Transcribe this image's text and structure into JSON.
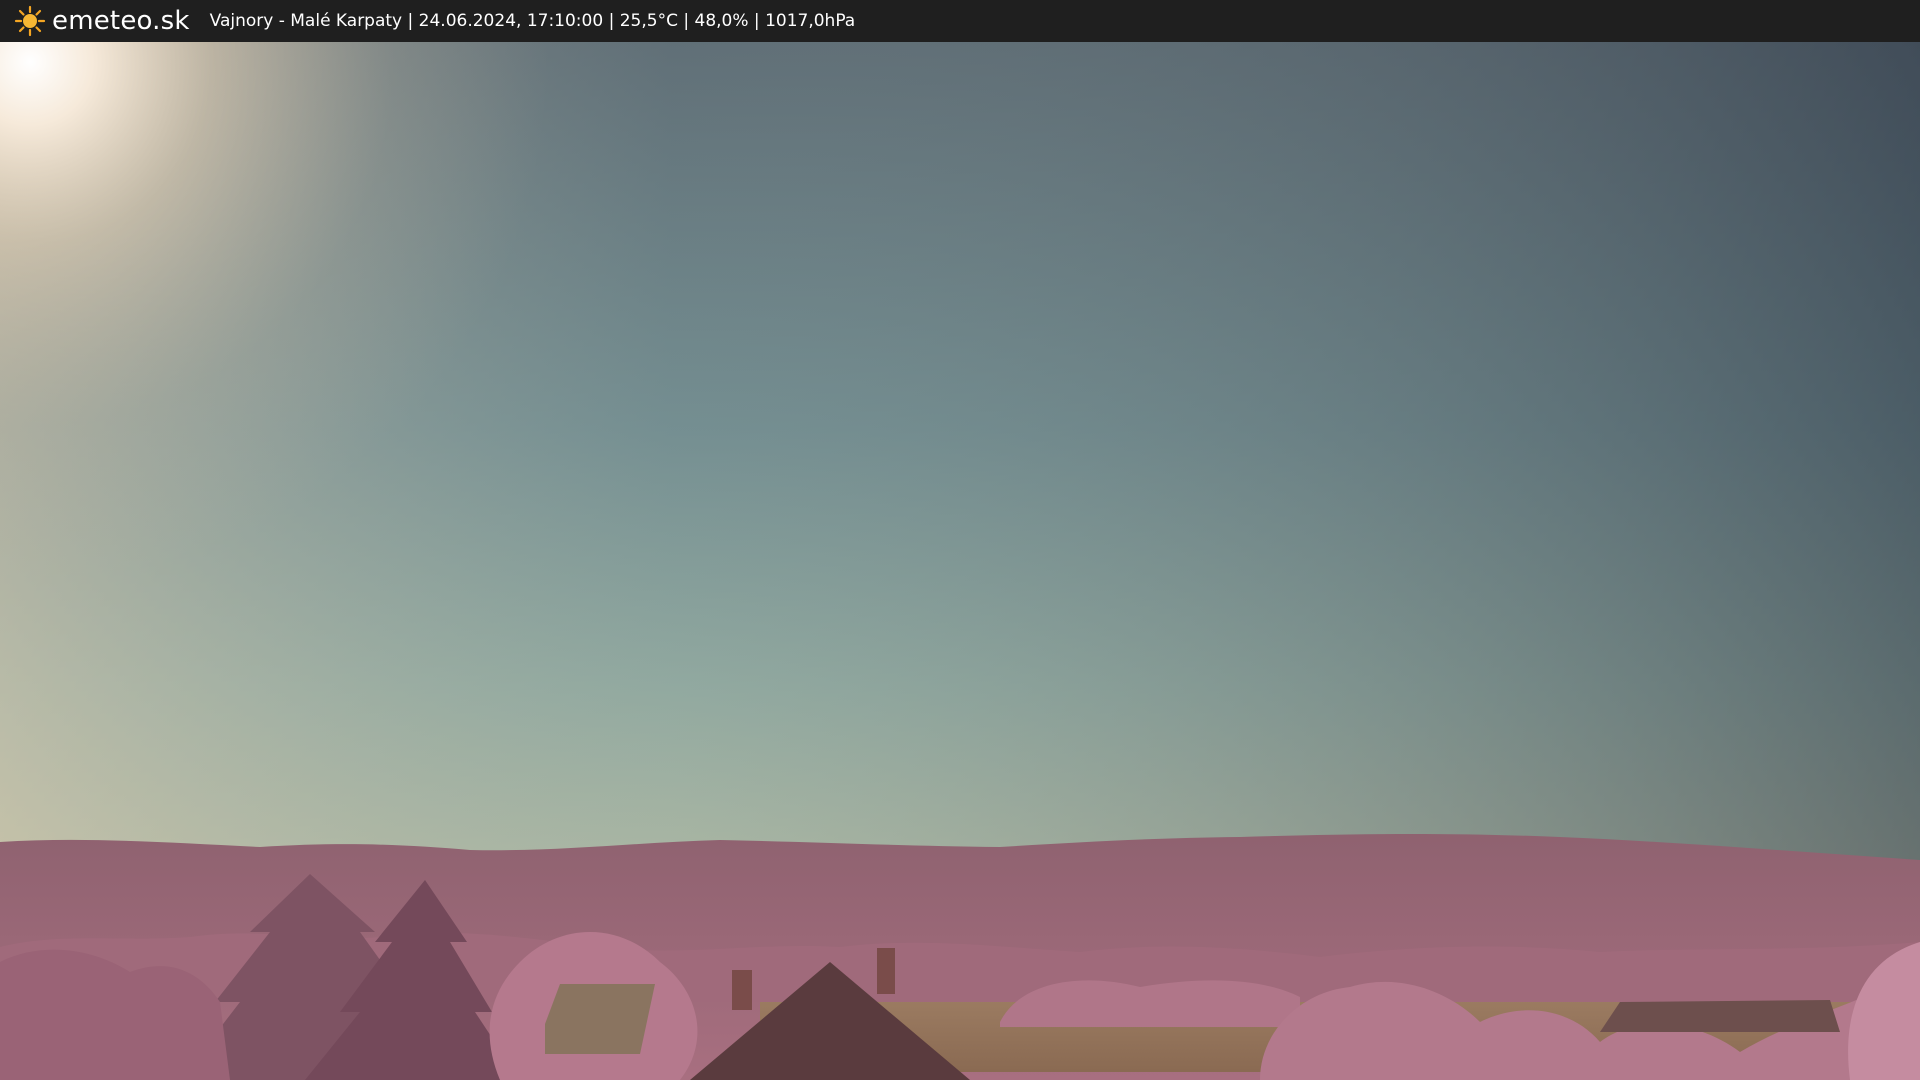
{
  "header": {
    "brand": "emeteo.sk",
    "brand_icon": "sun-icon",
    "location": "Vajnory - Malé Karpaty",
    "sep1": "|",
    "datetime": "24.06.2024, 17:10:00",
    "sep2": "|",
    "temperature": "25,5°C",
    "sep3": "|",
    "humidity": "48,0%",
    "sep4": "|",
    "pressure": "1017,0hPa"
  },
  "colors": {
    "topbar": "#1f1f1f",
    "sky_top_right": "#3f4a55",
    "sky_mid": "#6f8a90",
    "sky_horizon": "#a8b8a0",
    "vegetation": "#9a5a6e",
    "field": "#8a6e55",
    "sun_glow": "#f5e6cc"
  }
}
